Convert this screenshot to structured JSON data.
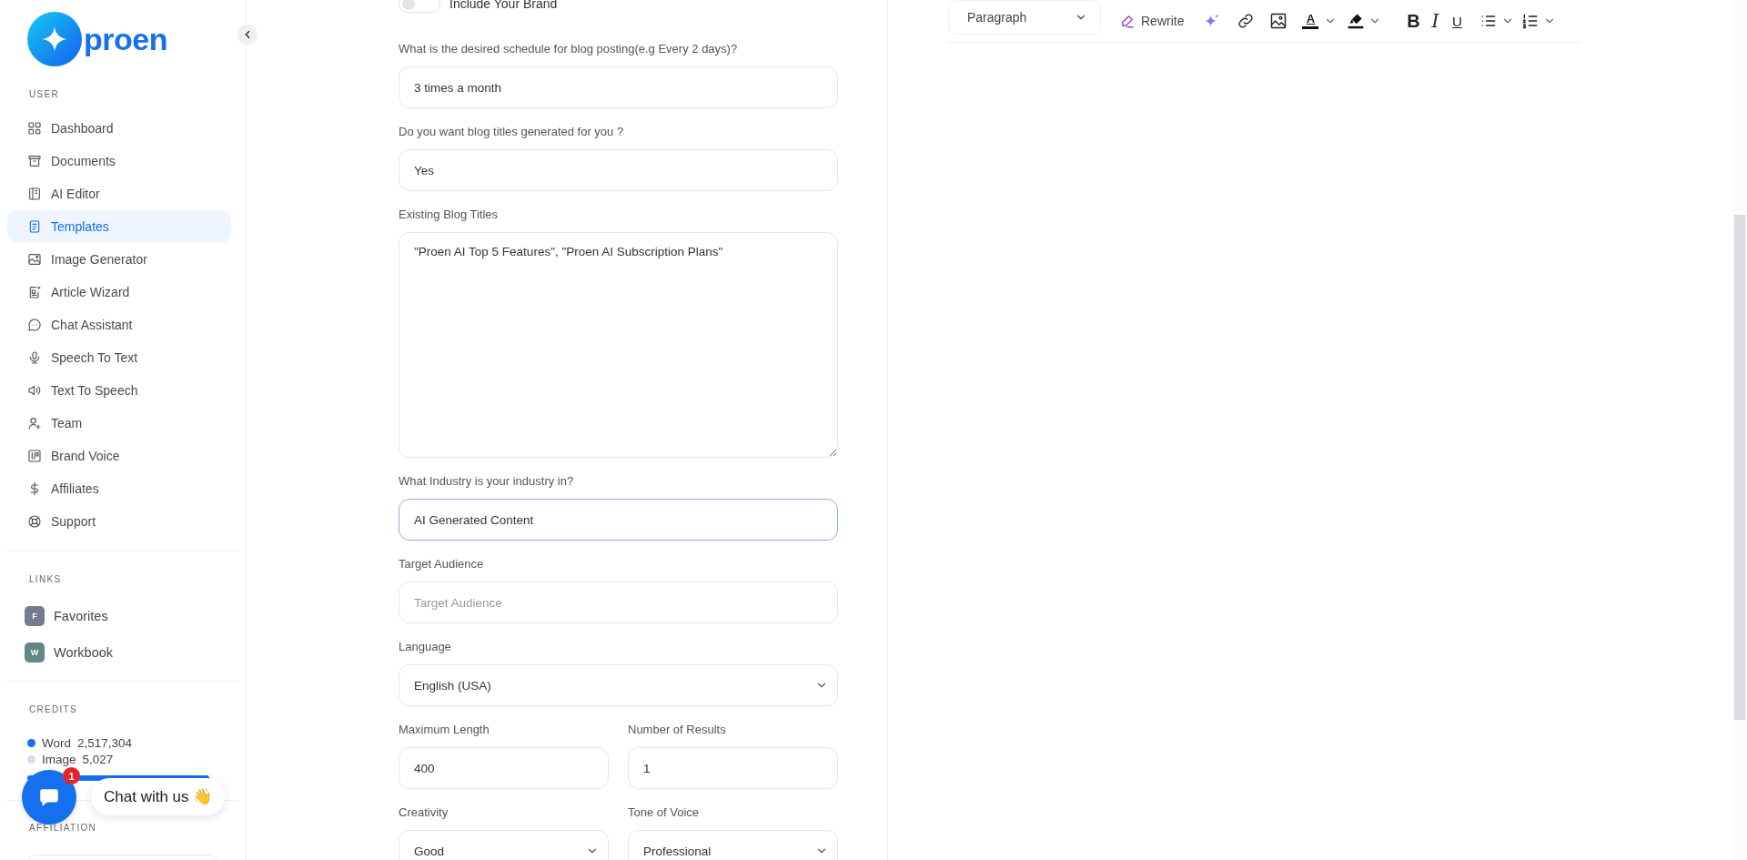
{
  "brand": {
    "name": "proen"
  },
  "sidebar": {
    "sections": [
      {
        "title": "USER",
        "items": [
          {
            "label": "Dashboard",
            "selected": false
          },
          {
            "label": "Documents",
            "selected": false
          },
          {
            "label": "AI Editor",
            "selected": false
          },
          {
            "label": "Templates",
            "selected": true
          },
          {
            "label": "Image Generator",
            "selected": false
          },
          {
            "label": "Article Wizard",
            "selected": false
          },
          {
            "label": "Chat Assistant",
            "selected": false
          },
          {
            "label": "Speech To Text",
            "selected": false
          },
          {
            "label": "Text To Speech",
            "selected": false
          },
          {
            "label": "Team",
            "selected": false
          },
          {
            "label": "Brand Voice",
            "selected": false
          },
          {
            "label": "Affiliates",
            "selected": false
          },
          {
            "label": "Support",
            "selected": false
          }
        ]
      }
    ],
    "links_title": "LINKS",
    "links": [
      {
        "letter": "F",
        "label": "Favorites",
        "color": "#737b8d"
      },
      {
        "letter": "W",
        "label": "Workbook",
        "color": "#5f8986"
      }
    ],
    "credits_title": "CREDITS",
    "credits": [
      {
        "label": "Word",
        "value": "2,517,304",
        "color": "#1570ef"
      },
      {
        "label": "Image",
        "value": "5,027",
        "color": "#d5deec"
      }
    ],
    "affiliation_title": "AFFILIATION"
  },
  "chat": {
    "badge": "1",
    "label": "Chat with us 👋"
  },
  "form": {
    "toggle": {
      "label": "Include Your Brand",
      "on": false
    },
    "rows": [
      [
        {
          "kind": "input",
          "label": "What is the desired schedule for blog posting(e.g Every 2 days)?",
          "value": "3 times a month",
          "focused": false
        }
      ],
      [
        {
          "kind": "input",
          "label": "Do you want blog titles generated for you ?",
          "value": "Yes",
          "focused": false
        }
      ],
      [
        {
          "kind": "textarea",
          "label": "Existing Blog Titles",
          "value": "\"Proen AI Top 5 Features\", \"Proen AI Subscription Plans\"",
          "focused": false
        }
      ],
      [
        {
          "kind": "input",
          "label": "What Industry is your industry in?",
          "value": "AI Generated Content",
          "focused": true
        }
      ],
      [
        {
          "kind": "input",
          "label": "Target Audience",
          "placeholder": "Target Audience",
          "focused": false
        }
      ],
      [
        {
          "kind": "select",
          "label": "Language",
          "value": "English (USA)",
          "focused": false
        }
      ],
      [
        {
          "kind": "input",
          "label": "Maximum Length",
          "value": "400",
          "focused": false
        },
        {
          "kind": "input",
          "label": "Number of Results",
          "value": "1",
          "focused": false
        }
      ],
      [
        {
          "kind": "select",
          "label": "Creativity",
          "value": "Good",
          "focused": false
        },
        {
          "kind": "select",
          "label": "Tone of Voice",
          "value": "Professional",
          "focused": false
        }
      ]
    ]
  },
  "editor": {
    "block_style": "Paragraph",
    "rewrite": "Rewrite",
    "text_color": "A",
    "format_buttons": [
      {
        "label": "B"
      },
      {
        "label": "I"
      },
      {
        "label": "U"
      }
    ]
  }
}
